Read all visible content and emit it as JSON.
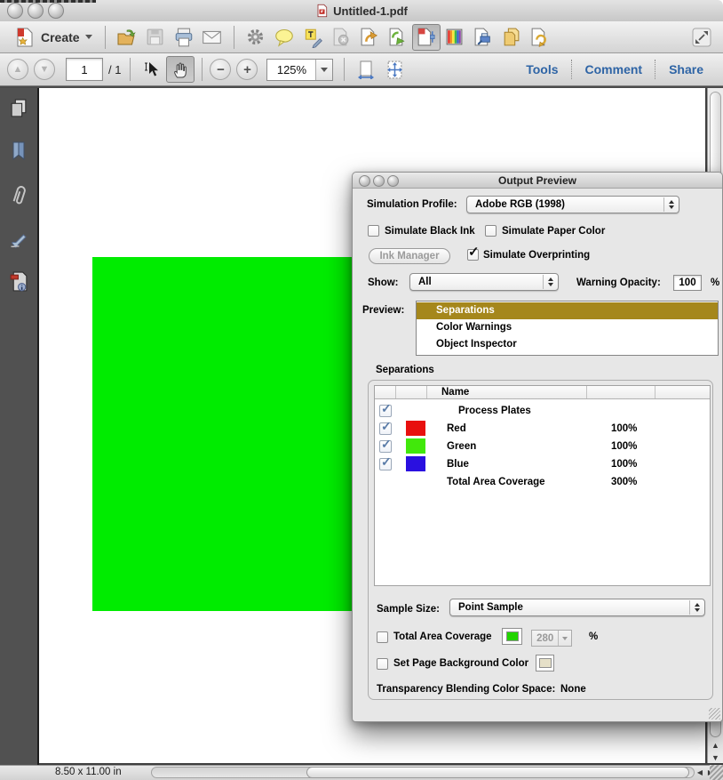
{
  "window": {
    "title": "Untitled-1.pdf",
    "status_dimensions": "8.50 x 11.00 in"
  },
  "toolbar": {
    "create_label": "Create"
  },
  "nav": {
    "page_current": "1",
    "page_total": "/ 1",
    "zoom_level": "125%",
    "tools_label": "Tools",
    "comment_label": "Comment",
    "share_label": "Share"
  },
  "icons": {
    "pdf-doc-icon": "red pdf page",
    "folder-open-icon": "gold folder + green arrow",
    "save-icon": "gray floppy disk (disabled)",
    "print-icon": "printer",
    "email-icon": "envelope",
    "gear-icon": "gear",
    "comment-bubble-icon": "yellow speech bubble",
    "highlight-text-icon": "page with yellow T and pen",
    "page-x-icon": "page with x badge (disabled)",
    "export-orange-icon": "page with orange arrow",
    "export-green-icon": "page with green arrow",
    "output-preview-icon": "page with red block and slider (pressed)",
    "color-bars-icon": "rainbow stripes",
    "print-production-icon": "page with blue printer",
    "combine-files-icon": "two gold pages",
    "action-wizard-icon": "page with gold curved arrow",
    "expand-icon": "diagonal resize arrows",
    "prev-page-icon": "up arrow circle (disabled)",
    "next-page-icon": "down arrow circle (disabled)",
    "select-tool-icon": "arrow cursor",
    "hand-tool-icon": "hand (pressed)",
    "zoom-out-icon": "minus circle",
    "zoom-in-icon": "plus circle",
    "fit-width-icon": "page with horizontal arrows",
    "fit-page-icon": "page with four-way arrows",
    "pages-panel-icon": "stacked pages",
    "bookmarks-panel-icon": "bookmark ribbon",
    "attachments-panel-icon": "paperclip",
    "signature-panel-icon": "signing pen",
    "standards-panel-icon": "page with red tag and info dot"
  },
  "dialog": {
    "title": "Output Preview",
    "simulation_profile": {
      "label": "Simulation Profile:",
      "value": "Adobe RGB (1998)"
    },
    "checkboxes": {
      "black_ink": "Simulate Black Ink",
      "paper_color": "Simulate Paper Color",
      "overprinting": "Simulate Overprinting"
    },
    "ink_manager_label": "Ink Manager",
    "show": {
      "label": "Show:",
      "value": "All"
    },
    "warning_opacity": {
      "label": "Warning Opacity:",
      "value": "100",
      "unit": "%"
    },
    "preview": {
      "label": "Preview:",
      "options": [
        "Separations",
        "Color Warnings",
        "Object Inspector"
      ],
      "selected": "Separations"
    },
    "separations": {
      "group_label": "Separations",
      "name_header": "Name",
      "rows": [
        {
          "name": "Process Plates",
          "checked": true,
          "swatch": null,
          "pct": "",
          "indent": true
        },
        {
          "name": "Red",
          "checked": true,
          "swatch": "#E8100E",
          "pct": "100%"
        },
        {
          "name": "Green",
          "checked": true,
          "swatch": "#41E80B",
          "pct": "100%"
        },
        {
          "name": "Blue",
          "checked": true,
          "swatch": "#2A10E0",
          "pct": "100%"
        },
        {
          "name": "Total Area Coverage",
          "checked": false,
          "swatch": null,
          "pct": "300%"
        }
      ]
    },
    "sample_size": {
      "label": "Sample Size:",
      "value": "Point Sample"
    },
    "total_area_coverage": {
      "label": "Total Area Coverage",
      "value": "280",
      "unit": "%"
    },
    "set_page_bg": {
      "label": "Set Page Background Color"
    },
    "transparency": {
      "label": "Transparency Blending Color Space:",
      "value": "None"
    }
  },
  "colors": {
    "selection_olive": "#A5871C",
    "page_green": "#00EC00",
    "tac_swatch_green": "#22D400",
    "page_bg_swatch": "#E6E0C8",
    "link_blue": "#2E64A5"
  }
}
